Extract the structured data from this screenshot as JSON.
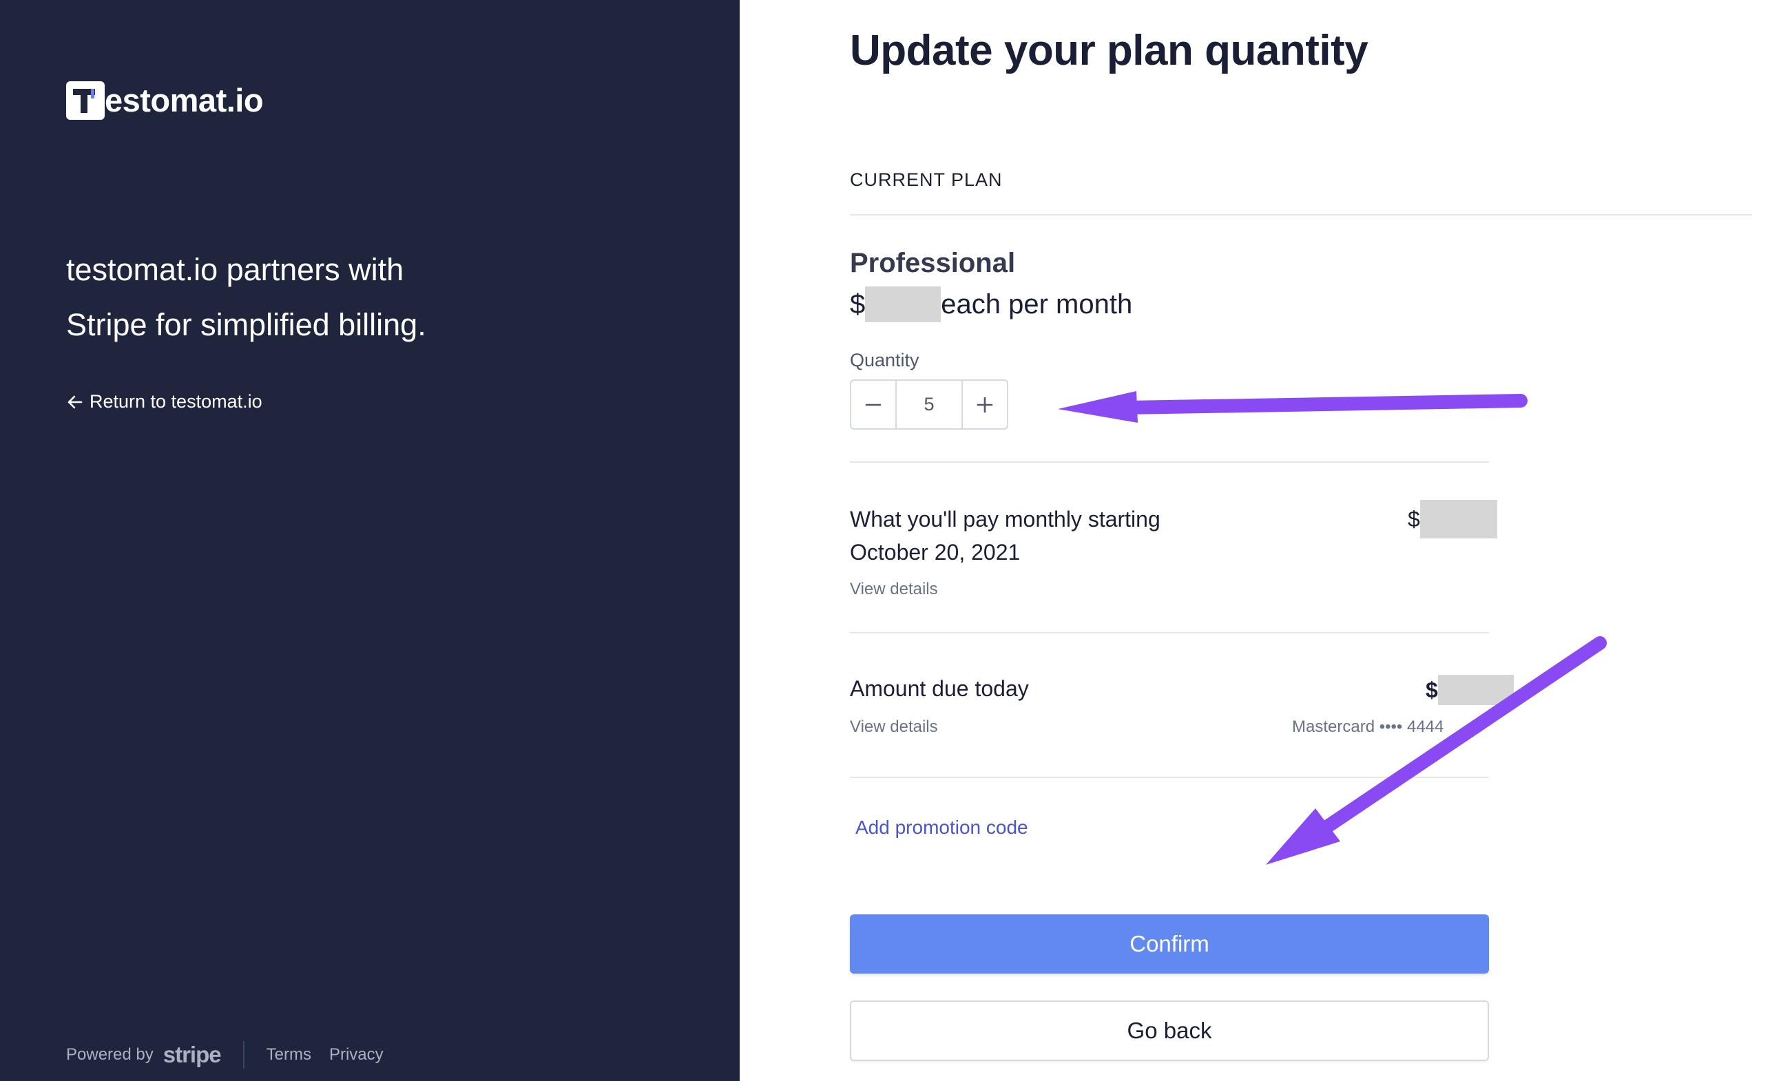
{
  "brand": {
    "name": "estomat.io",
    "icon": "testomat-logo-icon"
  },
  "sidebar": {
    "tagline_line1": "testomat.io partners with",
    "tagline_line2": "Stripe for simplified billing.",
    "return_label": "Return to testomat.io",
    "return_icon": "arrow-left-icon"
  },
  "footer": {
    "powered_by": "Powered by",
    "stripe_logo": "stripe",
    "terms": "Terms",
    "privacy": "Privacy"
  },
  "main": {
    "title": "Update your plan quantity",
    "section_label": "CURRENT PLAN",
    "plan": {
      "name": "Professional",
      "currency_symbol": "$",
      "price_suffix": "each per month"
    },
    "quantity": {
      "label": "Quantity",
      "value": "5",
      "minus_icon": "minus-icon",
      "plus_icon": "plus-icon"
    },
    "monthly": {
      "label_line1": "What you'll pay monthly starting",
      "label_line2": "October 20, 2021",
      "details_link": "View details",
      "amount_prefix": "$"
    },
    "due_today": {
      "label": "Amount due today",
      "details_link": "View details",
      "amount_prefix": "$",
      "card_info": "Mastercard •••• 4444"
    },
    "promo_link": "Add promotion code",
    "confirm_label": "Confirm",
    "back_label": "Go back"
  },
  "colors": {
    "sidebar_bg": "#1f253d",
    "primary_button": "#6189f0",
    "link": "#4a55c8",
    "annotation_arrow": "#8a4af3",
    "redaction": "#d6d6d6"
  }
}
